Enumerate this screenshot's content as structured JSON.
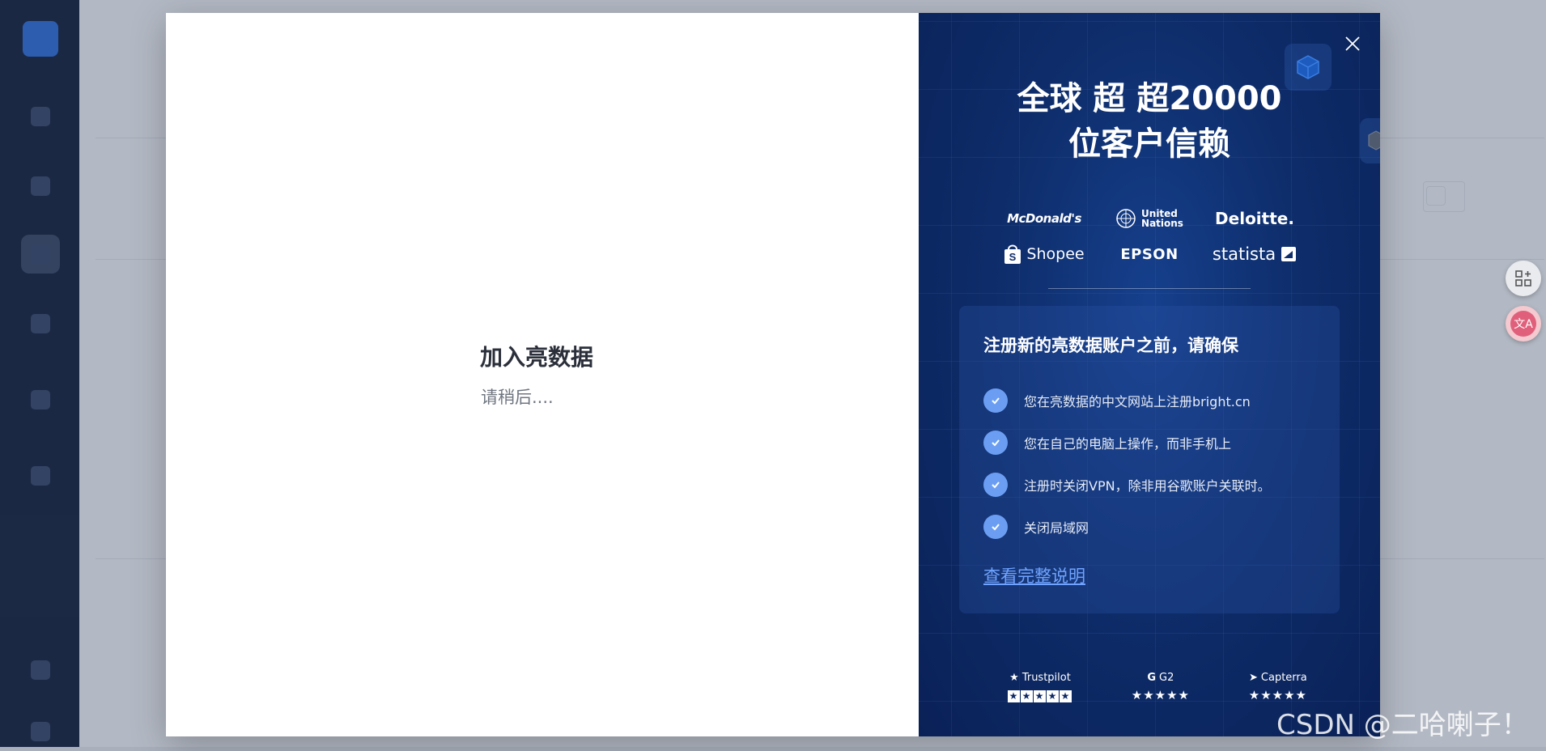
{
  "modal": {
    "left": {
      "title": "加入亮数据",
      "subtitle": "请稍后...."
    },
    "right": {
      "headline_line1": "全球 超 超20000",
      "headline_line2": "位客户信赖",
      "logos": {
        "mcdonalds": "McDonald's",
        "un_line1": "United",
        "un_line2": "Nations",
        "deloitte": "Deloitte.",
        "shopee": "Shopee",
        "epson": "EPSON",
        "statista": "statista"
      },
      "card": {
        "title": "注册新的亮数据账户之前，请确保",
        "items": [
          "您在亮数据的中文网站上注册bright.cn",
          "您在自己的电脑上操作，而非手机上",
          "注册时关闭VPN，除非用谷歌账户关联时。",
          "关闭局域网"
        ],
        "link": "查看完整说明"
      },
      "ratings": {
        "trustpilot": "Trustpilot",
        "g2": "G2",
        "capterra": "Capterra"
      }
    }
  },
  "watermark": "CSDN @二哈喇子！",
  "colors": {
    "panel_bg": "#0e2d6b",
    "check_circle": "#6b9ef2",
    "link": "#6fa3ff"
  }
}
